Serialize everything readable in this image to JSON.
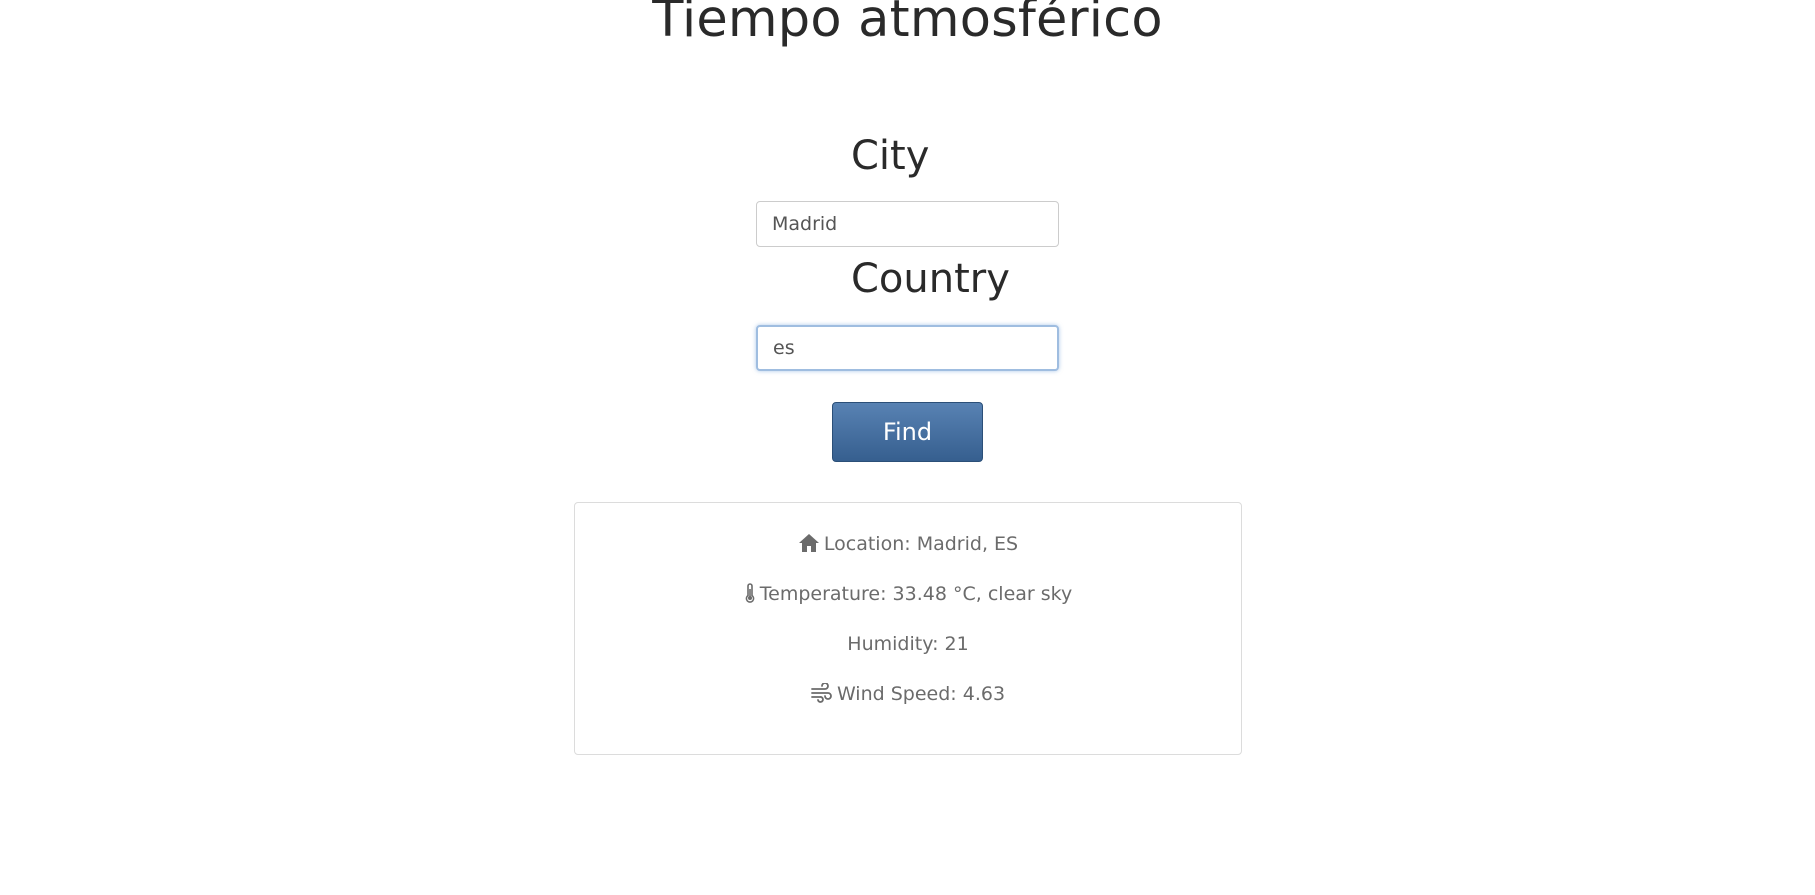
{
  "header": {
    "title": "Tiempo atmosférico"
  },
  "form": {
    "city_label": "City",
    "city_value": "Madrid",
    "country_label": "Country",
    "country_value": "es",
    "find_label": "Find"
  },
  "result": {
    "location": "Location: Madrid, ES",
    "location_icon": "home-icon",
    "temperature": "Temperature: 33.48 °C, clear sky",
    "temperature_icon": "thermometer-icon",
    "humidity": "Humidity: 21",
    "wind": "Wind Speed: 4.63",
    "wind_icon": "wind-icon"
  },
  "colors": {
    "button_top": "#5882b3",
    "button_bottom": "#365f8f",
    "focus_border": "#9fbde0",
    "result_text": "#6b6b6b"
  }
}
